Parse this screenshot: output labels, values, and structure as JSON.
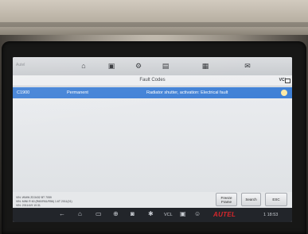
{
  "toolbar": {
    "left_text": "Autel",
    "icons": [
      "home-icon",
      "car-icon",
      "gear-icon",
      "print-icon",
      "help-icon",
      "message-icon"
    ]
  },
  "header": {
    "title": "Fault Codes",
    "vci_label": "VCI"
  },
  "fault_codes": [
    {
      "code": "C1900",
      "status": "Permanent",
      "description": "Radiator shutter, activation: Electrical fault"
    }
  ],
  "vehicle_info": {
    "line1": "VIN: WMW ZD3432 BT 7059",
    "line2": "VIN: MINI R 60 (R60/R61/R56) 1.6T 2011(01)",
    "line3": "VIN: 2011/4/9 10:31"
  },
  "buttons": {
    "freeze_frame": "Freeze Frame",
    "search": "Search",
    "esc": "ESC"
  },
  "navbar": {
    "vcl_label": "VCL",
    "brand": "AUTEL",
    "time": "1 18:53"
  }
}
